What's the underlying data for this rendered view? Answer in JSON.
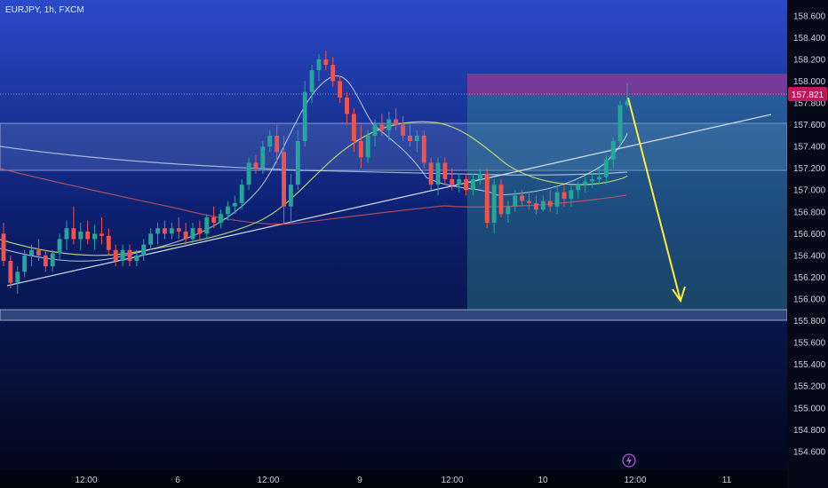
{
  "header": {
    "symbol_label": "EURJPY, 1h, FXCM"
  },
  "colors": {
    "up": "#26a69a",
    "down": "#ef5350",
    "background_top": "#2a4ac8",
    "background_bottom": "#020617",
    "target_arrow": "#ffeb3b",
    "resistance_zone": "#b03a7a",
    "target_zone": "#2e6e78"
  },
  "chart_data": {
    "type": "candlestick",
    "y_axis": {
      "ylim": [
        154.55,
        158.68
      ],
      "ticks": [
        "158.600",
        "158.400",
        "158.200",
        "158.000",
        "157.800",
        "157.600",
        "157.400",
        "157.200",
        "157.000",
        "156.800",
        "156.600",
        "156.400",
        "156.200",
        "156.000",
        "155.800",
        "155.600",
        "155.400",
        "155.200",
        "155.000",
        "154.800",
        "154.600"
      ]
    },
    "x_axis": {
      "ticks": [
        "12:00",
        "6",
        "12:00",
        "9",
        "12:00",
        "10",
        "12:00",
        "11"
      ]
    },
    "last_price": "157.821",
    "candles": [
      [
        156.6,
        156.7,
        156.3,
        156.35
      ],
      [
        156.35,
        156.4,
        156.1,
        156.15
      ],
      [
        156.15,
        156.3,
        156.05,
        156.25
      ],
      [
        156.25,
        156.45,
        156.2,
        156.4
      ],
      [
        156.4,
        156.5,
        156.3,
        156.45
      ],
      [
        156.45,
        156.55,
        156.35,
        156.4
      ],
      [
        156.4,
        156.45,
        156.25,
        156.3
      ],
      [
        156.3,
        156.45,
        156.25,
        156.42
      ],
      [
        156.42,
        156.6,
        156.35,
        156.55
      ],
      [
        156.55,
        156.72,
        156.45,
        156.65
      ],
      [
        156.65,
        156.85,
        156.5,
        156.55
      ],
      [
        156.55,
        156.7,
        156.45,
        156.62
      ],
      [
        156.62,
        156.72,
        156.5,
        156.55
      ],
      [
        156.55,
        156.68,
        156.45,
        156.6
      ],
      [
        156.6,
        156.75,
        156.5,
        156.58
      ],
      [
        156.58,
        156.65,
        156.4,
        156.45
      ],
      [
        156.45,
        156.5,
        156.3,
        156.35
      ],
      [
        156.35,
        156.5,
        156.3,
        156.45
      ],
      [
        156.45,
        156.5,
        156.3,
        156.35
      ],
      [
        156.35,
        156.45,
        156.3,
        156.4
      ],
      [
        156.4,
        156.55,
        156.35,
        156.5
      ],
      [
        156.5,
        156.65,
        156.45,
        156.6
      ],
      [
        156.6,
        156.7,
        156.5,
        156.65
      ],
      [
        156.65,
        156.72,
        156.55,
        156.6
      ],
      [
        156.6,
        156.7,
        156.55,
        156.65
      ],
      [
        156.65,
        156.75,
        156.55,
        156.62
      ],
      [
        156.62,
        156.7,
        156.5,
        156.55
      ],
      [
        156.55,
        156.7,
        156.5,
        156.65
      ],
      [
        156.65,
        156.72,
        156.55,
        156.6
      ],
      [
        156.6,
        156.78,
        156.55,
        156.75
      ],
      [
        156.75,
        156.85,
        156.65,
        156.7
      ],
      [
        156.7,
        156.82,
        156.65,
        156.78
      ],
      [
        156.78,
        156.9,
        156.72,
        156.85
      ],
      [
        156.85,
        156.95,
        156.78,
        156.88
      ],
      [
        156.88,
        157.1,
        156.82,
        157.05
      ],
      [
        157.05,
        157.3,
        157.0,
        157.25
      ],
      [
        157.25,
        157.32,
        157.15,
        157.2
      ],
      [
        157.2,
        157.45,
        157.15,
        157.4
      ],
      [
        157.4,
        157.55,
        157.35,
        157.5
      ],
      [
        157.5,
        157.6,
        157.25,
        157.35
      ],
      [
        157.35,
        157.5,
        156.7,
        156.85
      ],
      [
        156.85,
        157.15,
        156.7,
        157.05
      ],
      [
        157.05,
        157.55,
        157.0,
        157.45
      ],
      [
        157.45,
        158.0,
        157.4,
        157.9
      ],
      [
        157.9,
        158.15,
        157.8,
        158.1
      ],
      [
        158.1,
        158.25,
        158.0,
        158.2
      ],
      [
        158.2,
        158.28,
        158.1,
        158.15
      ],
      [
        158.15,
        158.22,
        157.95,
        158.0
      ],
      [
        158.0,
        158.05,
        157.8,
        157.85
      ],
      [
        157.85,
        157.9,
        157.6,
        157.7
      ],
      [
        157.7,
        157.75,
        157.35,
        157.45
      ],
      [
        157.45,
        157.6,
        157.2,
        157.3
      ],
      [
        157.3,
        157.55,
        157.25,
        157.5
      ],
      [
        157.5,
        157.65,
        157.4,
        157.6
      ],
      [
        157.6,
        157.7,
        157.5,
        157.55
      ],
      [
        157.55,
        157.72,
        157.45,
        157.65
      ],
      [
        157.65,
        157.75,
        157.55,
        157.6
      ],
      [
        157.6,
        157.68,
        157.45,
        157.5
      ],
      [
        157.5,
        157.6,
        157.4,
        157.45
      ],
      [
        157.45,
        157.55,
        157.35,
        157.5
      ],
      [
        157.5,
        157.55,
        157.2,
        157.25
      ],
      [
        157.25,
        157.3,
        157.0,
        157.05
      ],
      [
        157.05,
        157.3,
        156.95,
        157.25
      ],
      [
        157.25,
        157.3,
        157.05,
        157.1
      ],
      [
        157.1,
        157.2,
        157.0,
        157.05
      ],
      [
        157.05,
        157.15,
        156.98,
        157.1
      ],
      [
        157.1,
        157.15,
        156.95,
        157.0
      ],
      [
        157.0,
        157.15,
        156.95,
        157.1
      ],
      [
        157.1,
        157.2,
        157.05,
        157.15
      ],
      [
        157.15,
        157.2,
        156.65,
        156.7
      ],
      [
        156.7,
        157.1,
        156.6,
        157.05
      ],
      [
        157.05,
        157.1,
        156.75,
        156.78
      ],
      [
        156.78,
        156.9,
        156.7,
        156.85
      ],
      [
        156.85,
        157.0,
        156.8,
        156.95
      ],
      [
        156.95,
        157.0,
        156.85,
        156.9
      ],
      [
        156.9,
        156.98,
        156.82,
        156.88
      ],
      [
        156.88,
        156.95,
        156.78,
        156.82
      ],
      [
        156.82,
        156.95,
        156.8,
        156.9
      ],
      [
        156.9,
        157.0,
        156.8,
        156.85
      ],
      [
        156.85,
        157.05,
        156.78,
        156.98
      ],
      [
        156.98,
        157.05,
        156.85,
        156.92
      ],
      [
        156.92,
        157.05,
        156.85,
        157.0
      ],
      [
        157.0,
        157.08,
        156.92,
        157.05
      ],
      [
        157.05,
        157.12,
        156.98,
        157.08
      ],
      [
        157.08,
        157.15,
        157.02,
        157.1
      ],
      [
        157.1,
        157.2,
        157.05,
        157.12
      ],
      [
        157.12,
        157.32,
        157.05,
        157.28
      ],
      [
        157.28,
        157.48,
        157.2,
        157.45
      ],
      [
        157.45,
        157.82,
        157.4,
        157.78
      ],
      [
        157.78,
        157.98,
        157.75,
        157.82
      ]
    ],
    "zones": [
      {
        "label": "resistance",
        "range": [
          157.8,
          157.99
        ]
      },
      {
        "label": "target",
        "range": [
          155.91,
          157.8
        ]
      }
    ]
  }
}
